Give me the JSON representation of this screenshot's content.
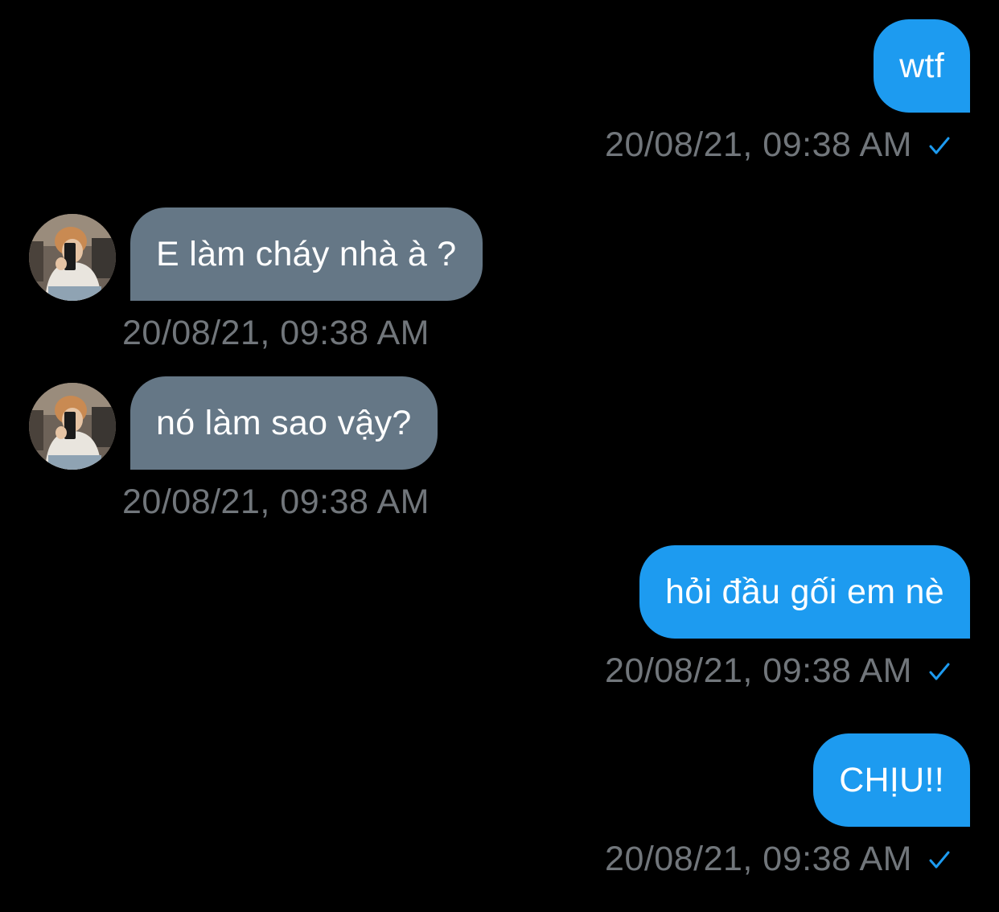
{
  "colors": {
    "background": "#000000",
    "sent_bubble": "#1d9bf0",
    "received_bubble": "#657786",
    "timestamp": "#71767b",
    "read_check": "#1d9bf0"
  },
  "messages": [
    {
      "direction": "sent",
      "text": "wtf",
      "timestamp": "20/08/21, 09:38 AM",
      "status_icon": "checkmark-icon"
    },
    {
      "direction": "received",
      "text": "E làm cháy nhà à ?",
      "timestamp": "20/08/21, 09:38 AM",
      "avatar": "user-avatar"
    },
    {
      "direction": "received",
      "text": "nó làm sao vậy?",
      "timestamp": "20/08/21, 09:38 AM",
      "avatar": "user-avatar"
    },
    {
      "direction": "sent",
      "text": "hỏi đầu gối em nè",
      "timestamp": "20/08/21, 09:38 AM",
      "status_icon": "checkmark-icon"
    },
    {
      "direction": "sent",
      "text": "CHỊU!!",
      "timestamp": "20/08/21, 09:38 AM",
      "status_icon": "checkmark-icon"
    }
  ]
}
